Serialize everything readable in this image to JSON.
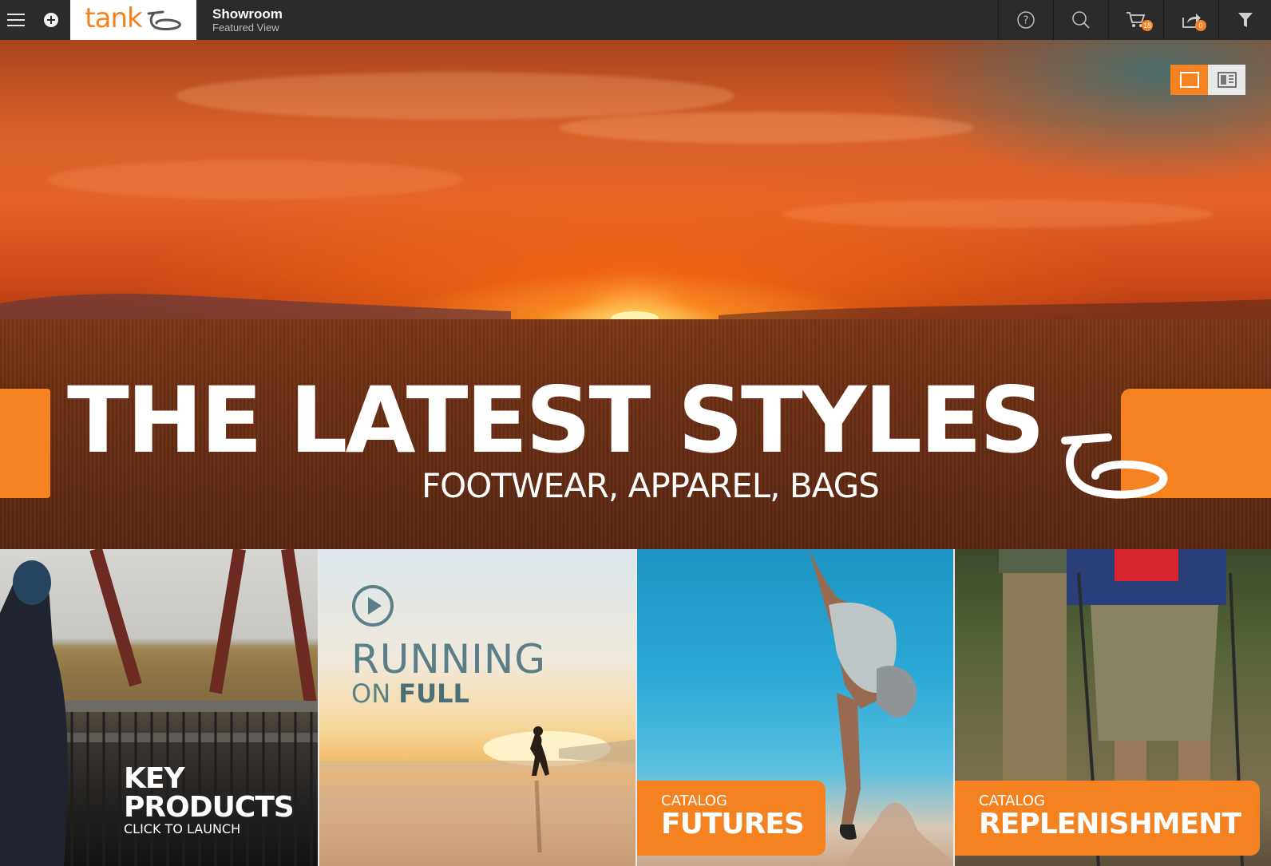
{
  "header": {
    "logo_text": "tank",
    "title": "Showroom",
    "subtitle": "Featured View",
    "cart_count": "18",
    "share_count": "0"
  },
  "hero": {
    "title": "THE LATEST STYLES",
    "subtitle": "FOOTWEAR, APPAREL, BAGS"
  },
  "tiles": [
    {
      "line1": "KEY",
      "line2": "PRODUCTS",
      "line3": "CLICK TO LAUNCH"
    },
    {
      "line1": "RUNNING",
      "line2a": "ON ",
      "line2b": "FULL"
    },
    {
      "small": "CATALOG",
      "big": "FUTURES"
    },
    {
      "small": "CATALOG",
      "big": "REPLENISHMENT"
    }
  ],
  "colors": {
    "accent": "#f58220",
    "topbar": "#2b2b2b"
  },
  "icons": [
    "menu-icon",
    "add-icon",
    "help-icon",
    "search-icon",
    "cart-icon",
    "share-icon",
    "filter-icon",
    "play-icon",
    "single-view-icon",
    "split-view-icon",
    "tank-logo-icon"
  ]
}
